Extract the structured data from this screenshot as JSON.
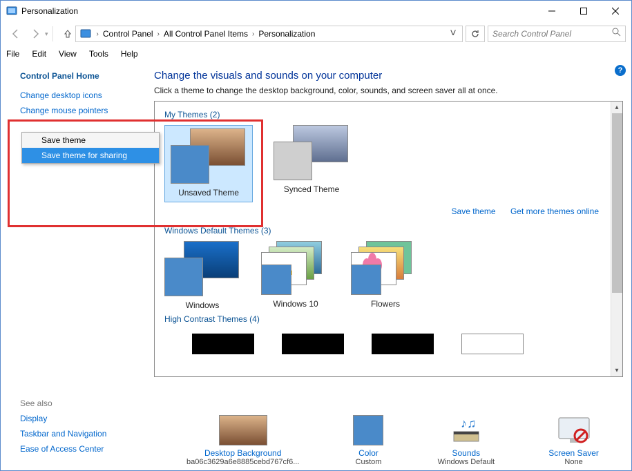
{
  "window": {
    "title": "Personalization"
  },
  "breadcrumbs": {
    "root": "Control Panel",
    "mid": "All Control Panel Items",
    "leaf": "Personalization"
  },
  "search": {
    "placeholder": "Search Control Panel"
  },
  "menubar": {
    "file": "File",
    "edit": "Edit",
    "view": "View",
    "tools": "Tools",
    "help": "Help"
  },
  "sidebar": {
    "home": "Control Panel Home",
    "links": [
      "Change desktop icons",
      "Change mouse pointers"
    ],
    "see_also_header": "See also",
    "see_also": [
      "Display",
      "Taskbar and Navigation",
      "Ease of Access Center"
    ]
  },
  "main": {
    "heading": "Change the visuals and sounds on your computer",
    "subtitle": "Click a theme to change the desktop background, color, sounds, and screen saver all at once."
  },
  "sections": {
    "my_themes": {
      "label": "My Themes (2)",
      "items": [
        "Unsaved Theme",
        "Synced Theme"
      ]
    },
    "links": {
      "save": "Save theme",
      "online": "Get more themes online"
    },
    "default_themes": {
      "label": "Windows Default Themes (3)",
      "items": [
        "Windows",
        "Windows 10",
        "Flowers"
      ]
    },
    "high_contrast": {
      "label": "High Contrast Themes (4)"
    }
  },
  "context_menu": {
    "items": [
      "Save theme",
      "Save theme for sharing"
    ]
  },
  "bottom": {
    "desktop_bg": {
      "label": "Desktop Background",
      "value": "ba06c3629a6e8885cebd767cf6..."
    },
    "color": {
      "label": "Color",
      "value": "Custom"
    },
    "sounds": {
      "label": "Sounds",
      "value": "Windows Default"
    },
    "screen_saver": {
      "label": "Screen Saver",
      "value": "None"
    }
  },
  "help_icon": "?"
}
